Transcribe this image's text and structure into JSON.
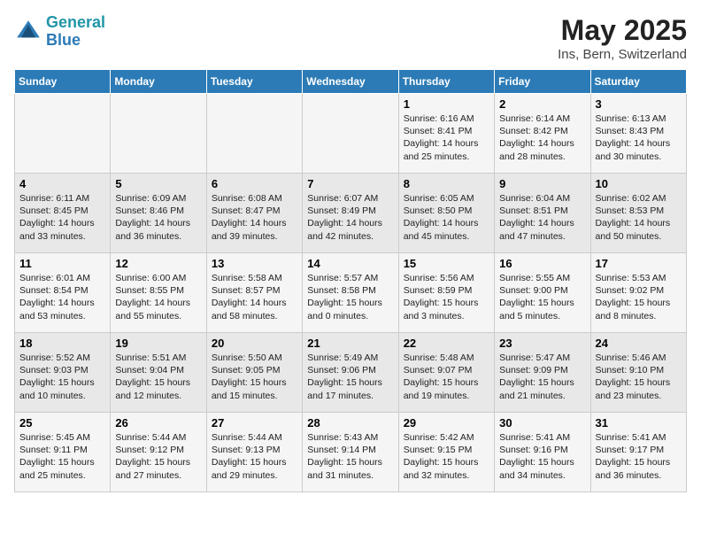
{
  "header": {
    "logo_line1": "General",
    "logo_line2": "Blue",
    "title": "May 2025",
    "subtitle": "Ins, Bern, Switzerland"
  },
  "weekdays": [
    "Sunday",
    "Monday",
    "Tuesday",
    "Wednesday",
    "Thursday",
    "Friday",
    "Saturday"
  ],
  "weeks": [
    [
      {
        "day": "",
        "detail": ""
      },
      {
        "day": "",
        "detail": ""
      },
      {
        "day": "",
        "detail": ""
      },
      {
        "day": "",
        "detail": ""
      },
      {
        "day": "1",
        "detail": "Sunrise: 6:16 AM\nSunset: 8:41 PM\nDaylight: 14 hours\nand 25 minutes."
      },
      {
        "day": "2",
        "detail": "Sunrise: 6:14 AM\nSunset: 8:42 PM\nDaylight: 14 hours\nand 28 minutes."
      },
      {
        "day": "3",
        "detail": "Sunrise: 6:13 AM\nSunset: 8:43 PM\nDaylight: 14 hours\nand 30 minutes."
      }
    ],
    [
      {
        "day": "4",
        "detail": "Sunrise: 6:11 AM\nSunset: 8:45 PM\nDaylight: 14 hours\nand 33 minutes."
      },
      {
        "day": "5",
        "detail": "Sunrise: 6:09 AM\nSunset: 8:46 PM\nDaylight: 14 hours\nand 36 minutes."
      },
      {
        "day": "6",
        "detail": "Sunrise: 6:08 AM\nSunset: 8:47 PM\nDaylight: 14 hours\nand 39 minutes."
      },
      {
        "day": "7",
        "detail": "Sunrise: 6:07 AM\nSunset: 8:49 PM\nDaylight: 14 hours\nand 42 minutes."
      },
      {
        "day": "8",
        "detail": "Sunrise: 6:05 AM\nSunset: 8:50 PM\nDaylight: 14 hours\nand 45 minutes."
      },
      {
        "day": "9",
        "detail": "Sunrise: 6:04 AM\nSunset: 8:51 PM\nDaylight: 14 hours\nand 47 minutes."
      },
      {
        "day": "10",
        "detail": "Sunrise: 6:02 AM\nSunset: 8:53 PM\nDaylight: 14 hours\nand 50 minutes."
      }
    ],
    [
      {
        "day": "11",
        "detail": "Sunrise: 6:01 AM\nSunset: 8:54 PM\nDaylight: 14 hours\nand 53 minutes."
      },
      {
        "day": "12",
        "detail": "Sunrise: 6:00 AM\nSunset: 8:55 PM\nDaylight: 14 hours\nand 55 minutes."
      },
      {
        "day": "13",
        "detail": "Sunrise: 5:58 AM\nSunset: 8:57 PM\nDaylight: 14 hours\nand 58 minutes."
      },
      {
        "day": "14",
        "detail": "Sunrise: 5:57 AM\nSunset: 8:58 PM\nDaylight: 15 hours\nand 0 minutes."
      },
      {
        "day": "15",
        "detail": "Sunrise: 5:56 AM\nSunset: 8:59 PM\nDaylight: 15 hours\nand 3 minutes."
      },
      {
        "day": "16",
        "detail": "Sunrise: 5:55 AM\nSunset: 9:00 PM\nDaylight: 15 hours\nand 5 minutes."
      },
      {
        "day": "17",
        "detail": "Sunrise: 5:53 AM\nSunset: 9:02 PM\nDaylight: 15 hours\nand 8 minutes."
      }
    ],
    [
      {
        "day": "18",
        "detail": "Sunrise: 5:52 AM\nSunset: 9:03 PM\nDaylight: 15 hours\nand 10 minutes."
      },
      {
        "day": "19",
        "detail": "Sunrise: 5:51 AM\nSunset: 9:04 PM\nDaylight: 15 hours\nand 12 minutes."
      },
      {
        "day": "20",
        "detail": "Sunrise: 5:50 AM\nSunset: 9:05 PM\nDaylight: 15 hours\nand 15 minutes."
      },
      {
        "day": "21",
        "detail": "Sunrise: 5:49 AM\nSunset: 9:06 PM\nDaylight: 15 hours\nand 17 minutes."
      },
      {
        "day": "22",
        "detail": "Sunrise: 5:48 AM\nSunset: 9:07 PM\nDaylight: 15 hours\nand 19 minutes."
      },
      {
        "day": "23",
        "detail": "Sunrise: 5:47 AM\nSunset: 9:09 PM\nDaylight: 15 hours\nand 21 minutes."
      },
      {
        "day": "24",
        "detail": "Sunrise: 5:46 AM\nSunset: 9:10 PM\nDaylight: 15 hours\nand 23 minutes."
      }
    ],
    [
      {
        "day": "25",
        "detail": "Sunrise: 5:45 AM\nSunset: 9:11 PM\nDaylight: 15 hours\nand 25 minutes."
      },
      {
        "day": "26",
        "detail": "Sunrise: 5:44 AM\nSunset: 9:12 PM\nDaylight: 15 hours\nand 27 minutes."
      },
      {
        "day": "27",
        "detail": "Sunrise: 5:44 AM\nSunset: 9:13 PM\nDaylight: 15 hours\nand 29 minutes."
      },
      {
        "day": "28",
        "detail": "Sunrise: 5:43 AM\nSunset: 9:14 PM\nDaylight: 15 hours\nand 31 minutes."
      },
      {
        "day": "29",
        "detail": "Sunrise: 5:42 AM\nSunset: 9:15 PM\nDaylight: 15 hours\nand 32 minutes."
      },
      {
        "day": "30",
        "detail": "Sunrise: 5:41 AM\nSunset: 9:16 PM\nDaylight: 15 hours\nand 34 minutes."
      },
      {
        "day": "31",
        "detail": "Sunrise: 5:41 AM\nSunset: 9:17 PM\nDaylight: 15 hours\nand 36 minutes."
      }
    ]
  ]
}
